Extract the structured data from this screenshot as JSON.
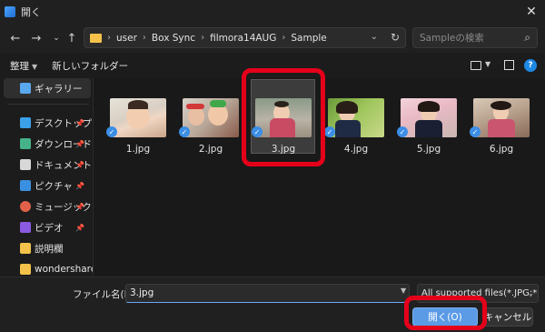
{
  "window": {
    "title": "開く"
  },
  "address": {
    "crumbs": [
      "user",
      "Box Sync",
      "filmora14AUG",
      "Sample"
    ]
  },
  "search": {
    "placeholder": "Sampleの検索"
  },
  "toolbar": {
    "organize": "整理",
    "new_folder": "新しいフォルダー"
  },
  "sidebar": {
    "items": [
      {
        "label": "ギャラリー",
        "icon": "gallery-icon",
        "color": "#5aa8ef"
      },
      {
        "label": "デスクトップ",
        "icon": "desktop-icon",
        "color": "#3aa0e8"
      },
      {
        "label": "ダウンロード",
        "icon": "download-icon",
        "color": "#46b28a"
      },
      {
        "label": "ドキュメント",
        "icon": "documents-icon",
        "color": "#d8d8d8"
      },
      {
        "label": "ピクチャ",
        "icon": "pictures-icon",
        "color": "#3a90e0"
      },
      {
        "label": "ミュージック",
        "icon": "music-icon",
        "color": "#e0604a"
      },
      {
        "label": "ビデオ",
        "icon": "videos-icon",
        "color": "#8a5ae0"
      },
      {
        "label": "説明欄",
        "icon": "folder-icon",
        "color": "#f4c24a"
      },
      {
        "label": "wondershare",
        "icon": "folder-icon",
        "color": "#f4c24a"
      }
    ]
  },
  "files": [
    {
      "name": "1.jpg"
    },
    {
      "name": "2.jpg"
    },
    {
      "name": "3.jpg"
    },
    {
      "name": "4.jpg"
    },
    {
      "name": "5.jpg"
    },
    {
      "name": "6.jpg"
    }
  ],
  "bottom": {
    "filename_label": "ファイル名(N):",
    "filename_value": "3.jpg",
    "filetype": "All supported files(*.JPG;*.",
    "open_label": "開く(O)",
    "cancel_label": "キャンセル"
  },
  "colors": {
    "accent": "#5b9be6",
    "highlight": "#e5001a"
  }
}
